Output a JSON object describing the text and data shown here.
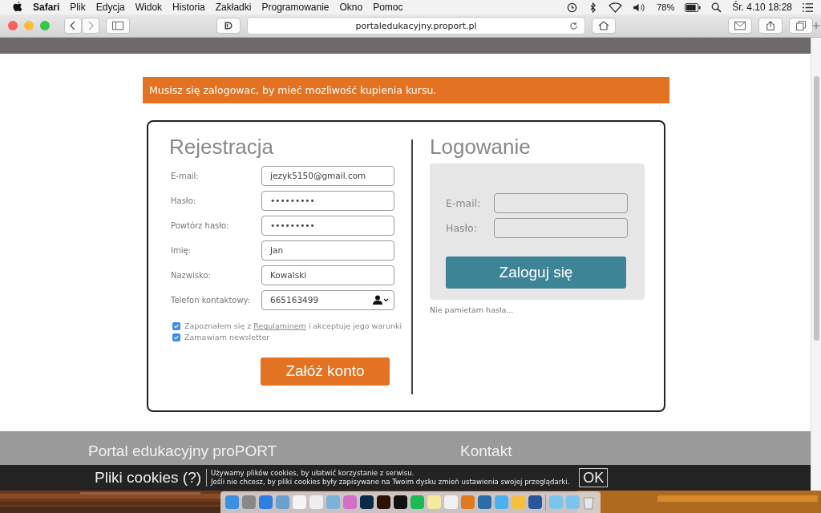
{
  "menu_bar": {
    "app": "Safari",
    "menus": [
      "Plik",
      "Edycja",
      "Widok",
      "Historia",
      "Zakładki",
      "Programowanie",
      "Okno",
      "Pomoc"
    ],
    "battery": "78%",
    "clock": "Śr. 4.10 18:28"
  },
  "toolbar": {
    "url": "portaledukacyjny.proport.pl"
  },
  "alert": "Musisz się zalogowac, by mieć mozliwość kupienia kursu.",
  "register": {
    "title": "Rejestracja",
    "fields": [
      {
        "label": "E-mail:",
        "value": "jezyk5150@gmail.com",
        "kind": "text"
      },
      {
        "label": "Hasło:",
        "value": "•••••••••",
        "kind": "text"
      },
      {
        "label": "Powtórz hasło:",
        "value": "•••••••••",
        "kind": "text"
      },
      {
        "label": "Imię:",
        "value": "Jan",
        "kind": "text"
      },
      {
        "label": "Nazwisko:",
        "value": "Kowalski",
        "kind": "text"
      },
      {
        "label": "Telefon kontaktowy:",
        "value": "665163499",
        "kind": "phone"
      }
    ],
    "checkboxes": [
      {
        "before": "Zapoznałem się z ",
        "link": "Regulaminem",
        "after": " i akceptuję jego warunki",
        "checked": true
      },
      {
        "before": "Zamawiam newsletter",
        "checked": true
      }
    ],
    "button": "Załóż konto"
  },
  "login": {
    "title": "Logowanie",
    "fields": [
      {
        "label": "E-mail:"
      },
      {
        "label": "Hasło:"
      }
    ],
    "button": "Zaloguj się",
    "forgot": "Nie pamietam hasła..."
  },
  "footer": {
    "columns": [
      "Portal edukacyjny proPORT",
      "Kontakt"
    ]
  },
  "cookie_bar": {
    "title": "Pliki cookies (?)",
    "lines": [
      "Używamy plików cookies, by ułatwić korzystanie z serwisu.",
      "Jeśli nie chcesz, by pliki cookies były zapisywane na Twoim dysku zmień ustawienia swojej przeglądarki."
    ],
    "button": "OK"
  }
}
